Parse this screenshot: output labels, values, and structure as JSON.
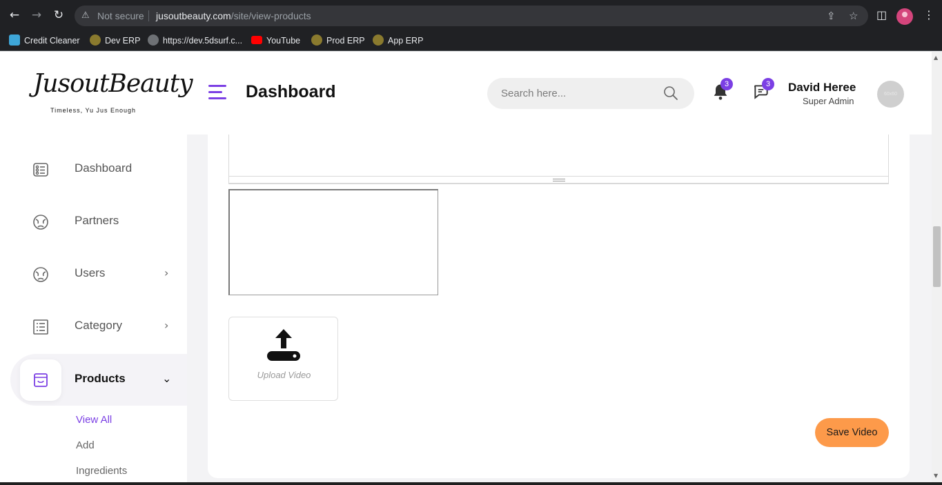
{
  "browser": {
    "security_label": "Not secure",
    "url_domain": "jusoutbeauty.com",
    "url_path": "/site/view-products",
    "bookmarks": [
      {
        "label": "Credit Cleaner",
        "icon": "credit-cleaner-icon"
      },
      {
        "label": "Dev ERP",
        "icon": "erp-icon"
      },
      {
        "label": "https://dev.5dsurf.c...",
        "icon": "globe-icon"
      },
      {
        "label": "YouTube",
        "icon": "youtube-icon"
      },
      {
        "label": "Prod ERP",
        "icon": "erp-icon"
      },
      {
        "label": "App ERP",
        "icon": "erp-icon"
      }
    ]
  },
  "brand": {
    "logo_text": "JusoutBeauty",
    "tagline": "Timeless, Yu Jus Enough"
  },
  "header": {
    "title": "Dashboard",
    "search_placeholder": "Search here...",
    "notification_count": "3",
    "message_count": "3",
    "user_name": "David Heree",
    "user_role": "Super Admin",
    "avatar_text": "60x60"
  },
  "sidebar": {
    "items": [
      {
        "label": "Dashboard",
        "icon": "dashboard-icon"
      },
      {
        "label": "Partners",
        "icon": "partners-icon"
      },
      {
        "label": "Users",
        "icon": "users-icon"
      },
      {
        "label": "Category",
        "icon": "category-icon"
      },
      {
        "label": "Products",
        "icon": "products-icon"
      }
    ],
    "sub_items": [
      "View All",
      "Add",
      "Ingredients"
    ]
  },
  "main": {
    "upload_label": "Upload Video",
    "save_button": "Save Video"
  },
  "colors": {
    "accent": "#7b3fe4",
    "save_button": "#fd9a4a"
  }
}
